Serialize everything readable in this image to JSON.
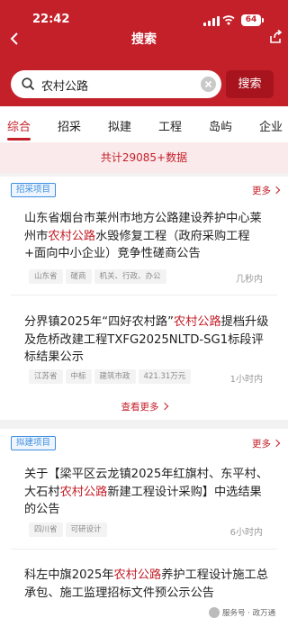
{
  "status": {
    "time": "22:42",
    "battery": "64"
  },
  "nav": {
    "title": "搜索"
  },
  "search": {
    "value": "农村公路",
    "button": "搜索"
  },
  "tabs": [
    {
      "label": "综合",
      "active": true
    },
    {
      "label": "招采"
    },
    {
      "label": "拟建"
    },
    {
      "label": "工程"
    },
    {
      "label": "岛屿"
    },
    {
      "label": "企业"
    }
  ],
  "result_count": "共计29085+数据",
  "sections": [
    {
      "tag": "招采项目",
      "more": "更多",
      "items": [
        {
          "title_pre": "山东省烟台市莱州市地方公路建设养护中心莱州市",
          "title_hl": "农村公路",
          "title_post": "水毁修复工程（政府采购工程+面向中小企业）竞争性磋商公告",
          "tags": [
            "山东省",
            "磋商",
            "机关、行政、办公"
          ],
          "time": "几秒内"
        },
        {
          "title_pre": "分界镇2025年“四好农村路”",
          "title_hl": "农村公路",
          "title_post": "提档升级及危桥改建工程TXFG2025NLTD-SG1标段评标结果公示",
          "tags": [
            "江苏省",
            "中标",
            "建筑市政",
            "421.31万元"
          ],
          "time": "1小时内"
        }
      ],
      "view_more": "查看更多"
    },
    {
      "tag": "拟建项目",
      "more": "更多",
      "items": [
        {
          "title_pre": "关于【梁平区云龙镇2025年红旗村、东平村、大石村",
          "title_hl": "农村公路",
          "title_post": "新建工程设计采购】中选结果的公告",
          "tags": [
            "四川省",
            "可研设计"
          ],
          "time": "6小时内"
        },
        {
          "title_pre": "科左中旗2025年",
          "title_hl": "农村公路",
          "title_post": "养护工程设计施工总承包、施工监理招标文件预公示公告",
          "tags": [],
          "time": ""
        }
      ]
    }
  ],
  "watermark": "服务号 · 政万通",
  "colors": {
    "brand": "#c4202a",
    "tag_blue": "#3e8ee0"
  }
}
